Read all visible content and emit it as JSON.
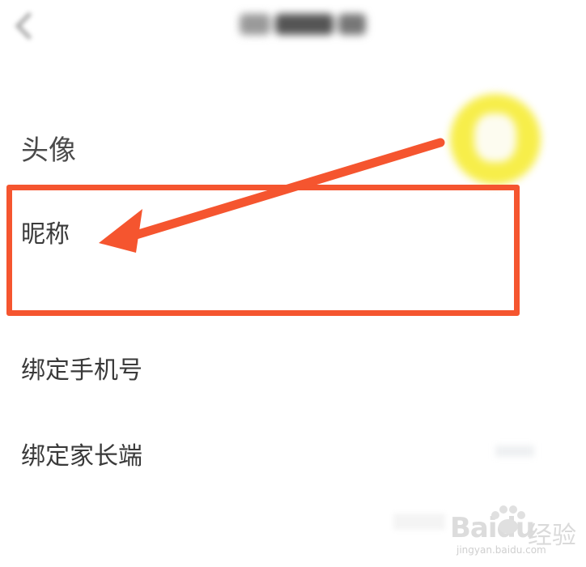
{
  "header": {
    "back_icon": "chevron-left-icon",
    "title_blurred": true
  },
  "profile": {
    "avatar_label": "头像",
    "avatar_color": "#f7ee4a",
    "nickname_label": "昵称",
    "phone_label": "绑定手机号",
    "parent_label": "绑定家长端"
  },
  "annotation": {
    "highlight_color": "#f5552f",
    "arrow_icon": "arrow-left-icon"
  },
  "watermark": {
    "logo": "Bai",
    "logo_suffix": "du",
    "product": "经验",
    "url": "jingyan.baidu.com"
  }
}
